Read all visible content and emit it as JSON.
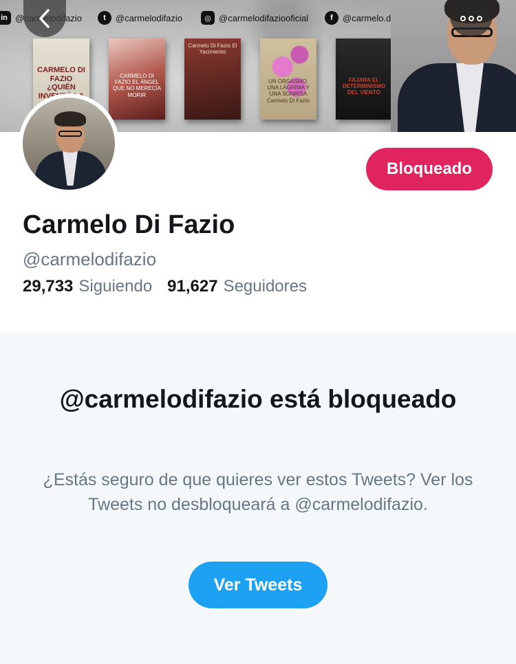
{
  "banner": {
    "social": [
      {
        "icon": "linkedin-icon",
        "glyph": "in",
        "handle": "@carmelodifazio"
      },
      {
        "icon": "twitter-icon",
        "glyph": "t",
        "handle": "@carmelodifazio"
      },
      {
        "icon": "instagram-icon",
        "glyph": "◎",
        "handle": "@carmelodifaziooficial"
      },
      {
        "icon": "facebook-icon",
        "glyph": "f",
        "handle": "@carmelo.d.fazio"
      }
    ],
    "books": [
      {
        "title": "CARMELO DI FAZIO ¿QUIÉN INVENTÓ LA CRISIS?"
      },
      {
        "title": "CARMELO DI FAZIO EL ÁNGEL QUE NO MERECÍA MORIR"
      },
      {
        "title": "Carmelo Di Fazio El Yacimiento"
      },
      {
        "title": "UN ORGASMO, UNA LÁGRIMA Y UNA SONRISA Carmelo Di Fazio"
      },
      {
        "title": "FAJARA EL DETERMINISMO DEL VIENTO"
      }
    ]
  },
  "nav": {
    "back_glyph": "‹"
  },
  "profile": {
    "blocked_label": "Bloqueado",
    "name": "Carmelo Di Fazio",
    "handle": "@carmelodifazio",
    "following_count": "29,733",
    "following_label": "Siguiendo",
    "followers_count": "91,627",
    "followers_label": "Seguidores"
  },
  "blocked": {
    "title": "@carmelodifazio está bloqueado",
    "description": "¿Estás seguro de que quieres ver estos Tweets? Ver los Tweets no desbloqueará a @carmelodifazio.",
    "view_button": "Ver Tweets"
  },
  "colors": {
    "blocked_red": "#e0245e",
    "twitter_blue": "#1da1f2",
    "muted_text": "#657786",
    "panel_bg": "#f5f8fa"
  }
}
